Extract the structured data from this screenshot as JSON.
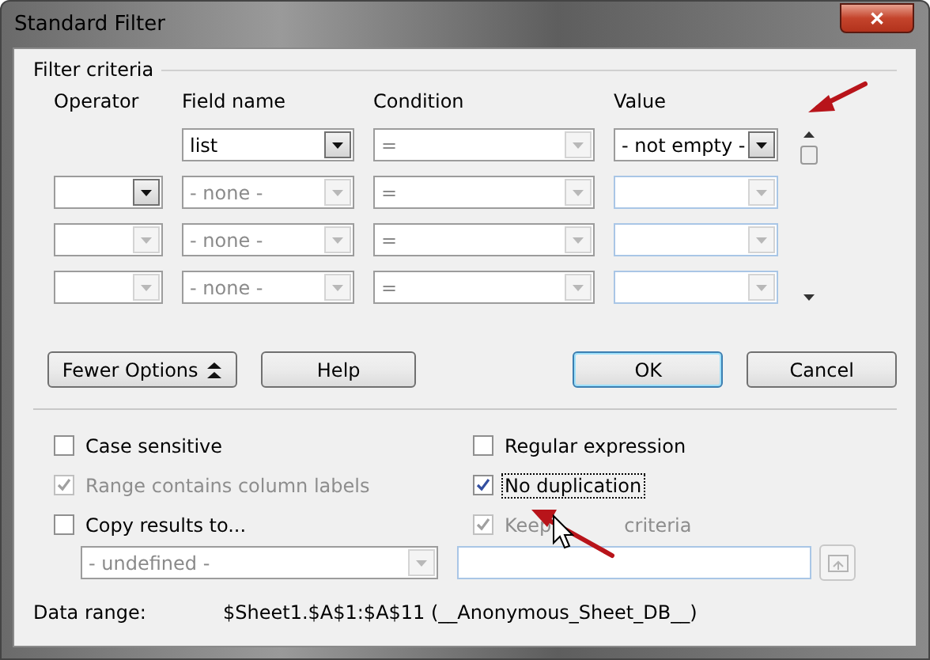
{
  "window": {
    "title": "Standard Filter",
    "close": "✕"
  },
  "criteria": {
    "title": "Filter criteria",
    "columns": [
      "Operator",
      "Field name",
      "Condition",
      "Value"
    ],
    "rows": [
      {
        "operator": null,
        "field": {
          "value": "list",
          "disabled": false
        },
        "condition": {
          "value": "=",
          "disabled": true
        },
        "value": {
          "value": "- not empty -",
          "disabled": false
        }
      },
      {
        "operator": {
          "disabled": false
        },
        "field": {
          "value": "- none -",
          "disabled": true
        },
        "condition": {
          "value": "=",
          "disabled": true
        },
        "value": {
          "disabled": true
        }
      },
      {
        "operator": {
          "disabled": true
        },
        "field": {
          "value": "- none -",
          "disabled": true
        },
        "condition": {
          "value": "=",
          "disabled": true
        },
        "value": {
          "disabled": true
        }
      },
      {
        "operator": {
          "disabled": true
        },
        "field": {
          "value": "- none -",
          "disabled": true
        },
        "condition": {
          "value": "=",
          "disabled": true
        },
        "value": {
          "disabled": true
        }
      }
    ]
  },
  "buttons": [
    {
      "label": "Fewer Options",
      "kind": "toggle",
      "default": false
    },
    {
      "label": "Help",
      "kind": "plain",
      "default": false
    },
    {
      "label": "OK",
      "kind": "plain",
      "default": true
    },
    {
      "label": "Cancel",
      "kind": "plain",
      "default": false
    }
  ],
  "options": [
    {
      "label": "Case sensitive",
      "checked": false,
      "disabled": false,
      "focused": false
    },
    {
      "label": "Regular expression",
      "checked": false,
      "disabled": false,
      "focused": false
    },
    {
      "label": "Range contains column labels",
      "checked": true,
      "disabled": true,
      "focused": false
    },
    {
      "label": "No duplication",
      "checked": true,
      "disabled": false,
      "focused": true
    },
    {
      "label": "Copy results to...",
      "checked": false,
      "disabled": false,
      "focused": false
    },
    {
      "label": "Keep",
      "label_2": "criteria",
      "checked": true,
      "disabled": true,
      "focused": false
    }
  ],
  "copy_target": {
    "value": "- undefined -",
    "disabled": true
  },
  "data_range": {
    "label": "Data range:",
    "value": "$Sheet1.$A$1:$A$11 (__Anonymous_Sheet_DB__)"
  }
}
